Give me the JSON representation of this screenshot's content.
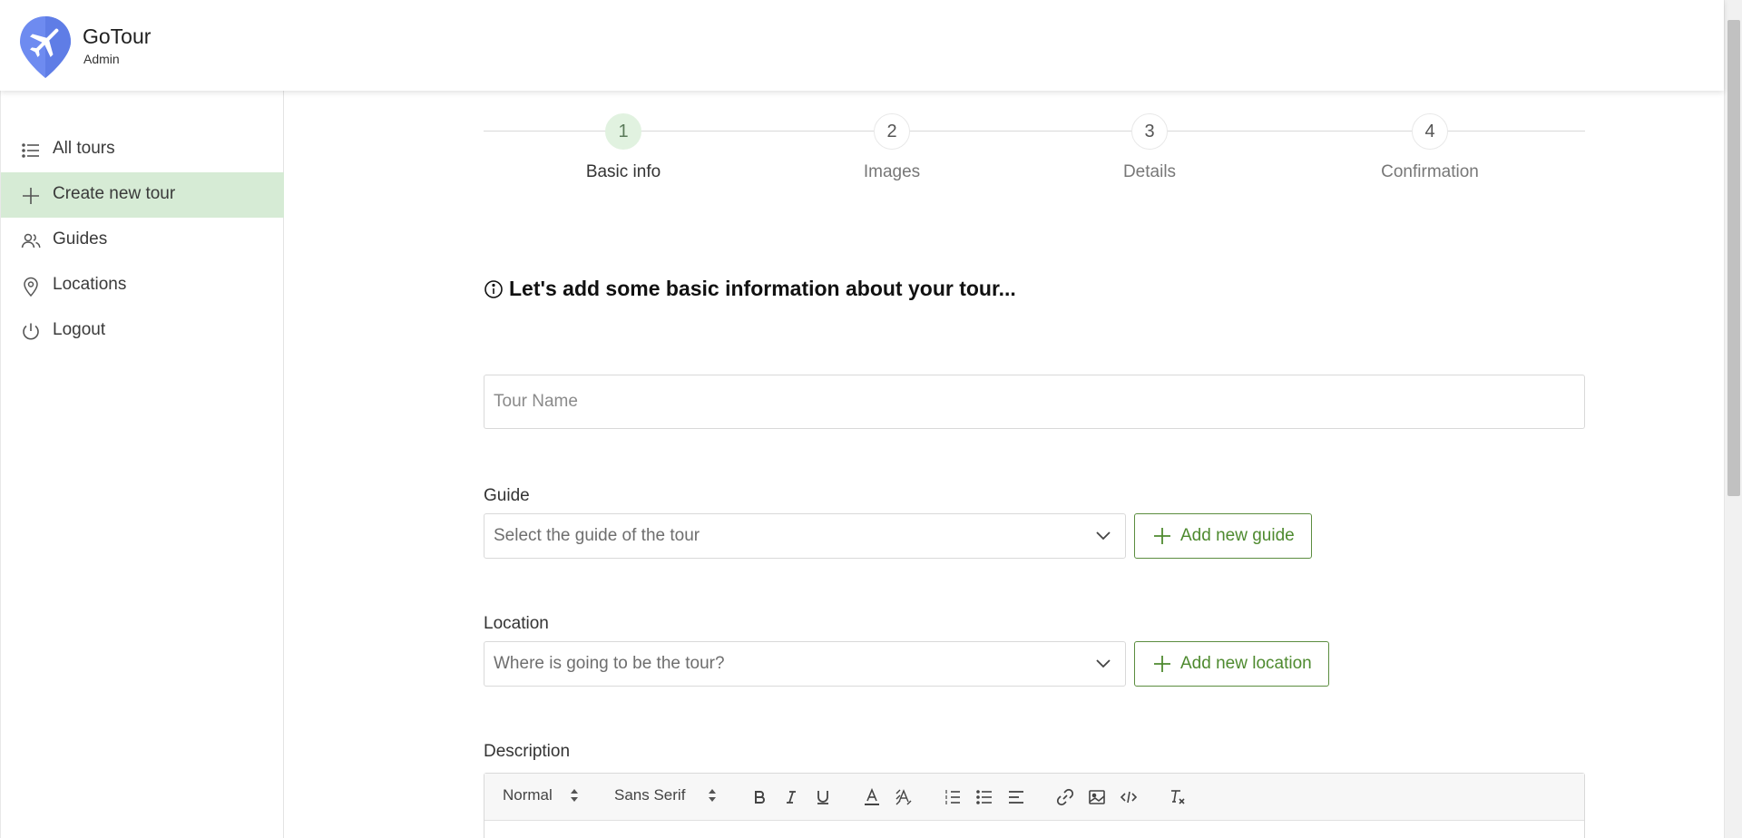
{
  "app": {
    "title": "GoTour",
    "subtitle": "Admin",
    "logo_icon": "airplane-pin-icon",
    "brand_color": "#6e8bf0"
  },
  "sidebar": {
    "active_color": "#d6ebd5",
    "items": [
      {
        "label": "All tours",
        "icon": "list-icon"
      },
      {
        "label": "Create new tour",
        "icon": "plus-icon"
      },
      {
        "label": "Guides",
        "icon": "users-icon"
      },
      {
        "label": "Locations",
        "icon": "map-pin-icon"
      },
      {
        "label": "Logout",
        "icon": "power-icon"
      }
    ]
  },
  "steps": [
    {
      "number": "1",
      "label": "Basic info"
    },
    {
      "number": "2",
      "label": "Images"
    },
    {
      "number": "3",
      "label": "Details"
    },
    {
      "number": "4",
      "label": "Confirmation"
    }
  ],
  "form": {
    "intro": "Let's add some basic information about your tour...",
    "tour_name_placeholder": "Tour Name",
    "tour_name_value": "",
    "guide_label": "Guide",
    "guide_placeholder": "Select the guide of the tour",
    "add_guide_label": "Add new guide",
    "location_label": "Location",
    "location_placeholder": "Where is going to be the tour?",
    "add_location_label": "Add new location",
    "description_label": "Description",
    "accent_color": "#4e8a2f"
  },
  "editor": {
    "format_value": "Normal",
    "font_value": "Sans Serif"
  }
}
